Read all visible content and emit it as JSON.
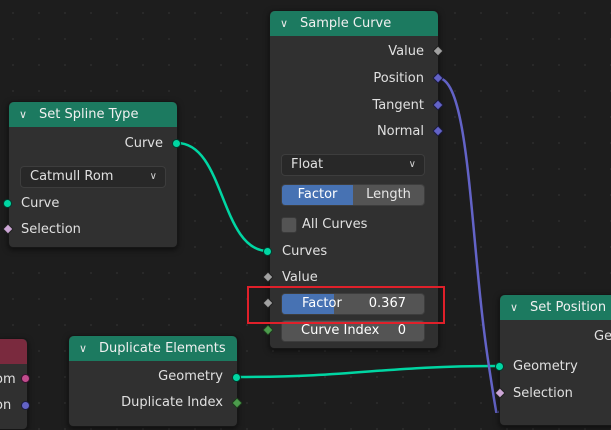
{
  "sample_curve": {
    "title": "Sample Curve",
    "outputs": [
      "Value",
      "Position",
      "Tangent",
      "Normal"
    ],
    "mode_dropdown": "Float",
    "mode_tabs": [
      "Factor",
      "Length"
    ],
    "active_tab": "Factor",
    "all_curves_label": "All Curves",
    "inputs": {
      "curves": "Curves",
      "value": "Value",
      "factor_label": "Factor",
      "factor_value": "0.367",
      "curve_index_label": "Curve Index",
      "curve_index_value": "0"
    }
  },
  "set_spline_type": {
    "title": "Set Spline Type",
    "output": "Curve",
    "spline_dropdown": "Catmull Rom",
    "inputs": [
      "Curve",
      "Selection"
    ]
  },
  "duplicate_elements": {
    "title": "Duplicate Elements",
    "outputs": [
      "Geometry",
      "Duplicate Index"
    ]
  },
  "set_position": {
    "title": "Set Position",
    "output_partial": "Ge",
    "inputs": [
      "Geometry",
      "Selection"
    ]
  },
  "partial_node_left": {
    "rows": [
      "om",
      "on"
    ]
  },
  "colors": {
    "header_geometry": "#1c7a60",
    "header_partial": "#7a2a3e",
    "geometry_socket": "#00d6a3",
    "vector_socket": "#6363c7",
    "highlight": "#e0202a"
  }
}
